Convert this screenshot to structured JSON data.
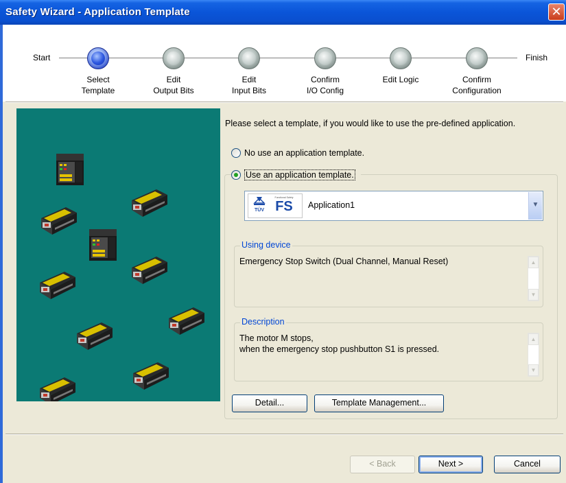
{
  "window": {
    "title": "Safety Wizard - Application Template",
    "close_glyph": "✕"
  },
  "steps": {
    "start_label": "Start",
    "finish_label": "Finish",
    "items": [
      {
        "label": "Select\nTemplate",
        "active": true
      },
      {
        "label": "Edit\nOutput Bits",
        "active": false
      },
      {
        "label": "Edit\nInput Bits",
        "active": false
      },
      {
        "label": "Confirm\nI/O Config",
        "active": false
      },
      {
        "label": "Edit Logic",
        "active": false
      },
      {
        "label": "Confirm\nConfiguration",
        "active": false
      }
    ]
  },
  "prompt": "Please select a template, if you would like to use the pre-defined application.",
  "options": {
    "no_template": "No use an application template.",
    "use_template": "Use an application template.",
    "selected": "use_template"
  },
  "template_combo": {
    "value": "Application1",
    "logo_left": "TÜV",
    "logo_right": "FS",
    "logo_caption": "Functional Safety"
  },
  "using_device": {
    "legend": "Using device",
    "text": "Emergency Stop Switch (Dual Channel, Manual Reset)"
  },
  "description": {
    "legend": "Description",
    "text": "The motor M stops,\nwhen the emergency stop pushbutton S1 is pressed."
  },
  "buttons": {
    "detail": "Detail...",
    "template_management": "Template Management...",
    "back": "< Back",
    "next": "Next >",
    "cancel": "Cancel"
  },
  "colors": {
    "titlebar": "#0a55d8",
    "panel_bg": "#0b7a74",
    "dialog_bg": "#ece9d8",
    "legend_text": "#0046d5"
  }
}
